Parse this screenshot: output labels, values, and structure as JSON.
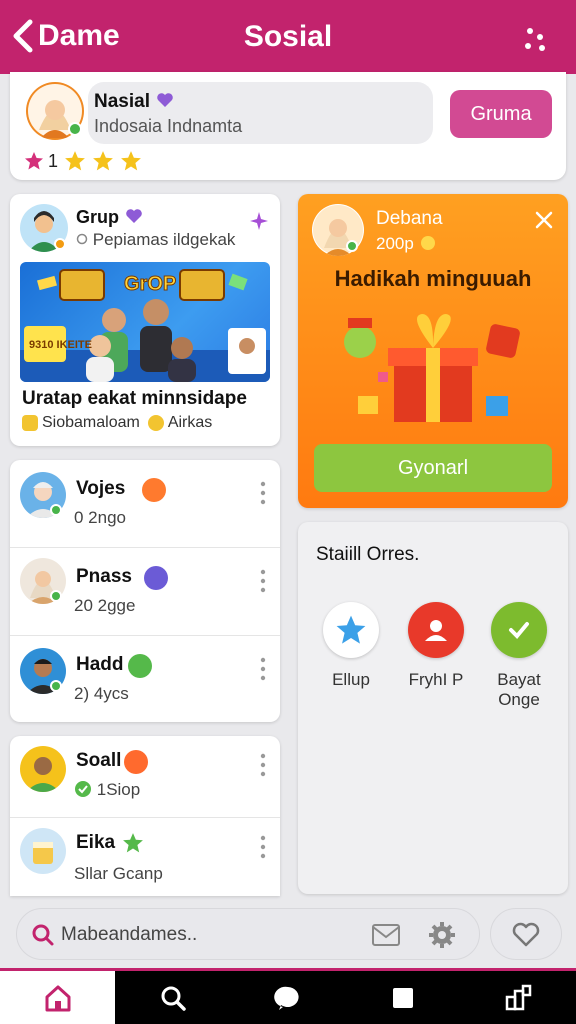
{
  "header": {
    "back_label": "Dame",
    "title": "Sosial"
  },
  "profile": {
    "name": "Nasial",
    "location": "Indosaia  Indnamta",
    "action_label": "Gruma",
    "rating_value": "1"
  },
  "group": {
    "name": "Grup",
    "subtitle": "Pepiamas ildgekak",
    "banner_title": "GrOP",
    "banner_tag": "9310 IKEITE",
    "headline": "Uratap eakat minnsidape",
    "tags": [
      "Siobamaloam",
      "Airkas"
    ]
  },
  "gift": {
    "name": "Debana",
    "points": "200p",
    "title": "Hadikah minguuah",
    "button_label": "Gyonarl"
  },
  "friends": [
    {
      "name": "Vojes",
      "meta": "0 2ngo"
    },
    {
      "name": "Pnass",
      "meta": "20 2gge"
    },
    {
      "name": "Hadd",
      "meta": "2) 4ycs"
    }
  ],
  "friends2": [
    {
      "name": "Soall",
      "meta": "1Siop"
    },
    {
      "name": "Eika",
      "meta": "Sllar Gcanp"
    }
  ],
  "orders": {
    "title": "Staiill Orres.",
    "items": [
      {
        "label": "Ellup",
        "icon": "star-icon"
      },
      {
        "label": "FryhI P",
        "icon": "person-icon"
      },
      {
        "label": "Bayat Onge",
        "icon": "check-icon"
      }
    ]
  },
  "search": {
    "placeholder": "Mabeandames.."
  },
  "colors": {
    "brand": "#c2236d",
    "accent_orange": "#ff8c1a",
    "green": "#8dc63f"
  }
}
